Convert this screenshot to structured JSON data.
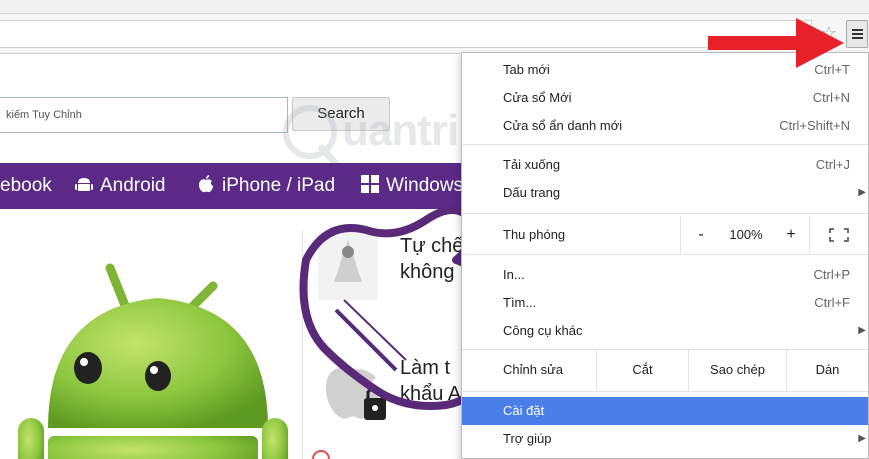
{
  "search": {
    "placeholder": "kiếm Tuy Chỉnh",
    "button_label": "Search"
  },
  "watermark": {
    "text": "uantrimang"
  },
  "nav": {
    "items": [
      {
        "label": "ebook",
        "icon": "facebook-icon"
      },
      {
        "label": "Android",
        "icon": "android-icon"
      },
      {
        "label": "iPhone / iPad",
        "icon": "apple-icon"
      },
      {
        "label": "Windows",
        "icon": "windows-icon"
      }
    ]
  },
  "side": {
    "item1_line1": "Tự chế",
    "item1_line2": "không",
    "item2_line1": "Làm t",
    "item2_line2": "khẩu A"
  },
  "menu": {
    "items": [
      {
        "label": "Tab mới",
        "shortcut": "Ctrl+T"
      },
      {
        "label": "Cửa sổ Mới",
        "shortcut": "Ctrl+N"
      },
      {
        "label": "Cửa sổ ẩn danh mới",
        "shortcut": "Ctrl+Shift+N"
      },
      {
        "label": "Tải xuống",
        "shortcut": "Ctrl+J"
      },
      {
        "label": "Dấu trang",
        "shortcut": ""
      }
    ],
    "zoom": {
      "label": "Thu phóng",
      "minus": "-",
      "value": "100%",
      "plus": "+"
    },
    "items2": [
      {
        "label": "In...",
        "shortcut": "Ctrl+P"
      },
      {
        "label": "Tìm...",
        "shortcut": "Ctrl+F"
      },
      {
        "label": "Công cụ khác",
        "shortcut": ""
      }
    ],
    "edit": {
      "label": "Chỉnh sửa",
      "cut": "Cắt",
      "copy": "Sao chép",
      "paste": "Dán"
    },
    "settings": "Cài đặt",
    "help": "Trợ giúp",
    "highlight_color": "#4a7ee8"
  },
  "colors": {
    "nav_bg": "#5b2a86",
    "arrow": "#e8202a",
    "android_green": "#8cc63f"
  }
}
